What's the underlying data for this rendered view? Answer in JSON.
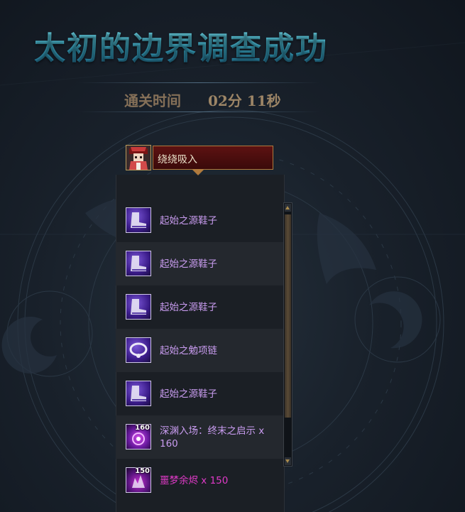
{
  "title": "太初的边界调查成功",
  "clear_time": {
    "label": "通关时间",
    "value": "02分 11秒"
  },
  "player": {
    "name": "绕绕吸入"
  },
  "loot": [
    {
      "icon": "shoes-icon",
      "label": "起始之源鞋子",
      "qty": ""
    },
    {
      "icon": "shoes-icon",
      "label": "起始之源鞋子",
      "qty": ""
    },
    {
      "icon": "shoes-icon",
      "label": "起始之源鞋子",
      "qty": ""
    },
    {
      "icon": "necklace-icon",
      "label": "起始之勉项链",
      "qty": ""
    },
    {
      "icon": "shoes-icon",
      "label": "起始之源鞋子",
      "qty": ""
    },
    {
      "icon": "abyss-ticket-icon",
      "label": "深渊入场：终末之启示 x 160",
      "qty": "160"
    },
    {
      "icon": "nightmare-ember-icon",
      "label": "噩梦余烬 x 150",
      "qty": "150"
    }
  ],
  "colors": {
    "title": "#5cc6da",
    "item_epic": "#c99cf0",
    "item_pink": "#e03ac8",
    "clear_time": "#9c8566"
  }
}
